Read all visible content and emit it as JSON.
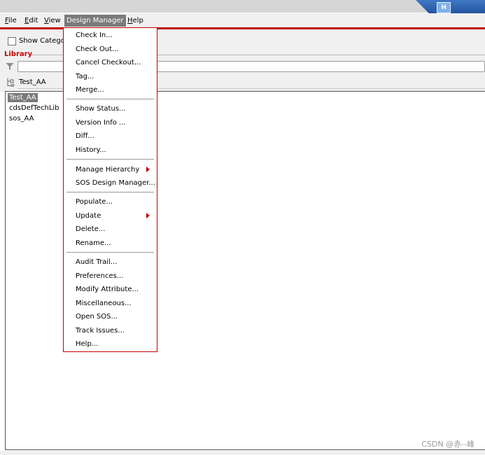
{
  "menubar": {
    "items": [
      {
        "label": "File",
        "mnemonic": "F",
        "rest": "ile"
      },
      {
        "label": "Edit",
        "mnemonic": "E",
        "rest": "dit"
      },
      {
        "label": "View",
        "mnemonic": "V",
        "rest": "iew"
      },
      {
        "label": "Design Manager"
      },
      {
        "label": "Help",
        "mnemonic": "H",
        "rest": "elp"
      }
    ]
  },
  "toolbar": {
    "show_categories_label": "Show Categor",
    "show_categories_checked": false,
    "library_label": "Library",
    "filter_value": "",
    "current_path": "Test_AA"
  },
  "library_list": {
    "items": [
      "Test_AA",
      "cdsDefTechLib",
      "sos_AA"
    ],
    "selected": "Test_AA"
  },
  "design_manager_menu": {
    "items": [
      "Check In...",
      "Check Out...",
      "Cancel Checkout...",
      "Tag...",
      "Merge...",
      "Show Status...",
      "Version Info ...",
      "Diff...",
      "History...",
      "Manage Hierarchy",
      "SOS Design Manager...",
      "Populate...",
      "Update",
      "Delete...",
      "Rename...",
      "Audit Trail...",
      "Preferences...",
      "Modify Attribute...",
      "Miscellaneous...",
      "Open SOS...",
      "Track Issues...",
      "Help..."
    ],
    "submenu_items": [
      "Manage Hierarchy",
      "Update"
    ]
  },
  "watermark": "CSDN @赤--峰",
  "colors": {
    "accent_red": "#c00000",
    "selection_gray": "#7a7a7a",
    "title_blue": "#1f4f98"
  },
  "icons": {
    "logo": "app-logo-icon",
    "filter": "filter-icon",
    "hierarchy": "hierarchy-icon",
    "submenu_arrow": "submenu-arrow-icon"
  }
}
